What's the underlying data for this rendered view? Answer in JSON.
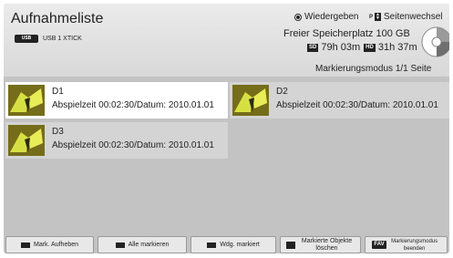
{
  "header": {
    "title": "Aufnahmeliste",
    "usb_icon_text": "USB",
    "usb_label": "USB 1 XTICK",
    "hint_play": "Wiedergeben",
    "hint_page_key": "P",
    "hint_page": "Seitenwechsel",
    "storage_label": "Freier Speicherplatz 100 GB",
    "sd_tag": "SD",
    "sd_time": "79h 03m",
    "hd_tag": "HD",
    "hd_time": "31h 37m",
    "mode": "Markierungsmodus 1/1 Seite",
    "disk_icon": "disk-icon"
  },
  "recordings": [
    {
      "name": "D1",
      "info": "Abspielzeit 00:02:30/Datum: 2010.01.01"
    },
    {
      "name": "D2",
      "info": "Abspielzeit 00:02:30/Datum: 2010.01.01"
    },
    {
      "name": "D3",
      "info": "Abspielzeit 00:02:30/Datum: 2010.01.01"
    }
  ],
  "footer": {
    "unmark": "Mark. Aufheben",
    "mark_all": "Alle markieren",
    "play_marked": "Wdg. markiert",
    "delete_marked": "Markierte Objekte löschen",
    "fav_key": "FAV",
    "end_mode": "Markierungsmodus beenden"
  },
  "colors": {
    "panel": "#c3c3c3",
    "header": "#e2e2e2",
    "selected_card": "#ffffff",
    "card": "#d4d4d4",
    "key": "#222222"
  }
}
